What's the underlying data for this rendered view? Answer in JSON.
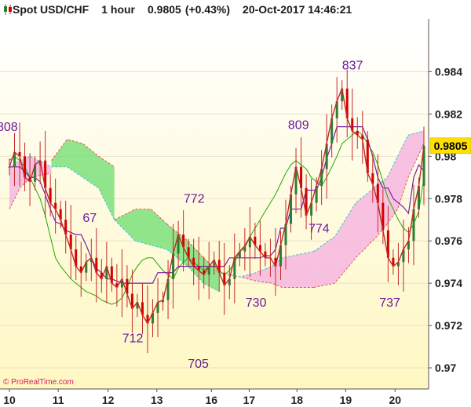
{
  "header": {
    "instrument": "Spot USD/CHF",
    "timeframe": "1 hour",
    "last": "0.9805",
    "change": "(+0.43%)",
    "datetime": "20-Oct-2017 14:46:21"
  },
  "watermark": "© ProRealTime.com",
  "colors": {
    "up": "#2e7d32",
    "down": "#d50000",
    "price_line": "#c62828",
    "tenkan": "#7b1fa2",
    "kijun": "#1faa00",
    "cloud_bull": "#7de07d",
    "cloud_bear": "#f7b6e0",
    "label": "#6a1b9a",
    "last_box": "#ffe000"
  },
  "chart_data": {
    "type": "line",
    "title": "Spot USD/CHF 1 hour",
    "ylim": [
      0.969,
      0.9865
    ],
    "y_ticks": [
      {
        "label": "0.984",
        "value": 0.984
      },
      {
        "label": "0.982",
        "value": 0.982
      },
      {
        "label": "0.98",
        "value": 0.98
      },
      {
        "label": "0.978",
        "value": 0.978
      },
      {
        "label": "0.976",
        "value": 0.976
      },
      {
        "label": "0.974",
        "value": 0.974
      },
      {
        "label": "0.972",
        "value": 0.972
      },
      {
        "label": "0.97",
        "value": 0.97
      }
    ],
    "x_ticks": [
      {
        "label": "10",
        "t": 0
      },
      {
        "label": "11",
        "t": 9.3
      },
      {
        "label": "12",
        "t": 18.8
      },
      {
        "label": "13",
        "t": 28.1
      },
      {
        "label": "16",
        "t": 38.5
      },
      {
        "label": "17",
        "t": 45.7
      },
      {
        "label": "18",
        "t": 54.8
      },
      {
        "label": "19",
        "t": 64.1
      },
      {
        "label": "20",
        "t": 73.5
      }
    ],
    "last_value": "0.9805",
    "x_max": 79,
    "price": [
      0.9795,
      0.9802,
      0.98,
      0.979,
      0.9788,
      0.9796,
      0.9798,
      0.9785,
      0.9778,
      0.9775,
      0.977,
      0.9763,
      0.9756,
      0.9748,
      0.9745,
      0.975,
      0.9752,
      0.9745,
      0.9742,
      0.9748,
      0.974,
      0.9738,
      0.9742,
      0.9735,
      0.9728,
      0.9731,
      0.9725,
      0.9721,
      0.9726,
      0.9731,
      0.9732,
      0.9742,
      0.9754,
      0.9763,
      0.9757,
      0.9752,
      0.9748,
      0.9746,
      0.9744,
      0.9748,
      0.9751,
      0.9745,
      0.9739,
      0.9742,
      0.9752,
      0.9755,
      0.9757,
      0.9762,
      0.9758,
      0.9755,
      0.9752,
      0.9752,
      0.9748,
      0.9758,
      0.9768,
      0.9782,
      0.9795,
      0.9785,
      0.9772,
      0.9778,
      0.9786,
      0.9794,
      0.9806,
      0.9818,
      0.9826,
      0.9832,
      0.9818,
      0.9812,
      0.981,
      0.9808,
      0.9792,
      0.9787,
      0.9778,
      0.9765,
      0.9752,
      0.9748,
      0.975,
      0.9756,
      0.976,
      0.9775,
      0.9786,
      0.9805
    ],
    "tenkan": [
      0.9795,
      0.9795,
      0.9795,
      0.9793,
      0.979,
      0.979,
      0.9788,
      0.9782,
      0.9775,
      0.9769,
      0.9768,
      0.9765,
      0.9764,
      0.9763,
      0.9763,
      0.9758,
      0.9752,
      0.9747,
      0.9745,
      0.9742,
      0.9742,
      0.9741,
      0.974,
      0.974,
      0.974,
      0.974,
      0.974,
      0.974,
      0.974,
      0.9745,
      0.9745,
      0.9745,
      0.9745,
      0.9748,
      0.9748,
      0.9748,
      0.9748,
      0.9748,
      0.9748,
      0.9748,
      0.9748,
      0.9748,
      0.9748,
      0.9752,
      0.9752,
      0.9752,
      0.9752,
      0.9752,
      0.9752,
      0.9752,
      0.9753,
      0.9753,
      0.9756,
      0.9766,
      0.9766,
      0.9775,
      0.9775,
      0.9775,
      0.9784,
      0.9784,
      0.9784,
      0.979,
      0.9799,
      0.9806,
      0.9814,
      0.9814,
      0.9814,
      0.9814,
      0.9814,
      0.9814,
      0.9808,
      0.98,
      0.979,
      0.9785,
      0.9785,
      0.978,
      0.9778,
      0.9776,
      0.9773,
      0.979,
      0.9796,
      0.9793
    ],
    "kijun": [
      0.9798,
      0.98,
      0.9798,
      0.9795,
      0.979,
      0.9785,
      0.978,
      0.9772,
      0.9762,
      0.9752,
      0.9748,
      0.9745,
      0.9742,
      0.974,
      0.9738,
      0.9736,
      0.9735,
      0.9734,
      0.9732,
      0.9731,
      0.973,
      0.9731,
      0.9733,
      0.9738,
      0.9744,
      0.9748,
      0.9751,
      0.9752,
      0.9752,
      0.9749,
      0.9746,
      0.9744,
      0.9742,
      0.9747,
      0.975,
      0.9752,
      0.975,
      0.9748,
      0.9746,
      0.9748,
      0.9748,
      0.9746,
      0.9744,
      0.9746,
      0.975,
      0.9755,
      0.9758,
      0.9762,
      0.9766,
      0.977,
      0.9774,
      0.9778,
      0.9782,
      0.9787,
      0.9792,
      0.9796,
      0.9798,
      0.9796,
      0.9794,
      0.979,
      0.9788,
      0.9786,
      0.979,
      0.9795,
      0.98,
      0.9806,
      0.9808,
      0.981,
      0.9812,
      0.981,
      0.9806,
      0.9802,
      0.9796,
      0.9788,
      0.978,
      0.9775,
      0.977,
      0.9766,
      0.9764,
      0.9768,
      0.9774,
      0.979
    ],
    "cloud": [
      {
        "kind": "bear",
        "span_a": [
          [
            0,
            0.9775
          ],
          [
            2,
            0.9785
          ],
          [
            4,
            0.979
          ],
          [
            8,
            0.9792
          ]
        ],
        "span_b": [
          [
            0,
            0.9795
          ],
          [
            2,
            0.9798
          ],
          [
            4,
            0.98
          ],
          [
            8,
            0.9795
          ]
        ]
      },
      {
        "kind": "bull",
        "span_a": [
          [
            8,
            0.9798
          ],
          [
            11,
            0.9808
          ],
          [
            14,
            0.9806
          ],
          [
            17,
            0.98
          ],
          [
            20,
            0.9795
          ]
        ],
        "span_b": [
          [
            8,
            0.9795
          ],
          [
            11,
            0.9795
          ],
          [
            14,
            0.979
          ],
          [
            17,
            0.9785
          ],
          [
            20,
            0.977
          ]
        ]
      },
      {
        "kind": "bull",
        "span_a": [
          [
            20,
            0.977
          ],
          [
            24,
            0.9775
          ],
          [
            27,
            0.9775
          ],
          [
            30,
            0.9768
          ]
        ],
        "span_b": [
          [
            20,
            0.977
          ],
          [
            24,
            0.976
          ],
          [
            27,
            0.9758
          ],
          [
            30,
            0.9756
          ]
        ]
      },
      {
        "kind": "bull",
        "span_a": [
          [
            30,
            0.9768
          ],
          [
            34,
            0.976
          ],
          [
            37,
            0.9752
          ],
          [
            40,
            0.9745
          ]
        ],
        "span_b": [
          [
            30,
            0.9756
          ],
          [
            34,
            0.9748
          ],
          [
            37,
            0.974
          ],
          [
            40,
            0.9736
          ]
        ]
      },
      {
        "kind": "bear",
        "span_a": [
          [
            40,
            0.9745
          ],
          [
            44,
            0.9743
          ],
          [
            47,
            0.9741
          ],
          [
            50,
            0.974
          ],
          [
            52,
            0.9738
          ],
          [
            58,
            0.9738
          ]
        ],
        "span_b": [
          [
            40,
            0.9745
          ],
          [
            44,
            0.9743
          ],
          [
            47,
            0.9745
          ],
          [
            50,
            0.9748
          ],
          [
            52,
            0.9752
          ],
          [
            58,
            0.9755
          ]
        ]
      },
      {
        "kind": "bear",
        "span_a": [
          [
            58,
            0.9738
          ],
          [
            62,
            0.974
          ],
          [
            66,
            0.9752
          ],
          [
            70,
            0.9762
          ],
          [
            72,
            0.9768
          ]
        ],
        "span_b": [
          [
            58,
            0.9755
          ],
          [
            62,
            0.9762
          ],
          [
            66,
            0.9778
          ],
          [
            70,
            0.9786
          ],
          [
            72,
            0.979
          ]
        ]
      },
      {
        "kind": "bear",
        "span_a": [
          [
            72,
            0.9768
          ],
          [
            74,
            0.9775
          ],
          [
            76,
            0.979
          ],
          [
            79,
            0.9806
          ]
        ],
        "span_b": [
          [
            72,
            0.979
          ],
          [
            74,
            0.98
          ],
          [
            76,
            0.981
          ],
          [
            79,
            0.9812
          ]
        ]
      }
    ],
    "annotations": [
      {
        "label": "808",
        "t": -0.4,
        "v": 0.9812
      },
      {
        "label": "67",
        "t": 15.3,
        "v": 0.9769
      },
      {
        "label": "712",
        "t": 23.5,
        "v": 0.9712
      },
      {
        "label": "772",
        "t": 35.2,
        "v": 0.9778
      },
      {
        "label": "705",
        "t": 36.0,
        "v": 0.97
      },
      {
        "label": "730",
        "t": 47.0,
        "v": 0.9729
      },
      {
        "label": "809",
        "t": 55.1,
        "v": 0.9813
      },
      {
        "label": "774",
        "t": 59.0,
        "v": 0.9764
      },
      {
        "label": "837",
        "t": 65.4,
        "v": 0.9841
      },
      {
        "label": "737",
        "t": 72.5,
        "v": 0.9729
      }
    ]
  }
}
